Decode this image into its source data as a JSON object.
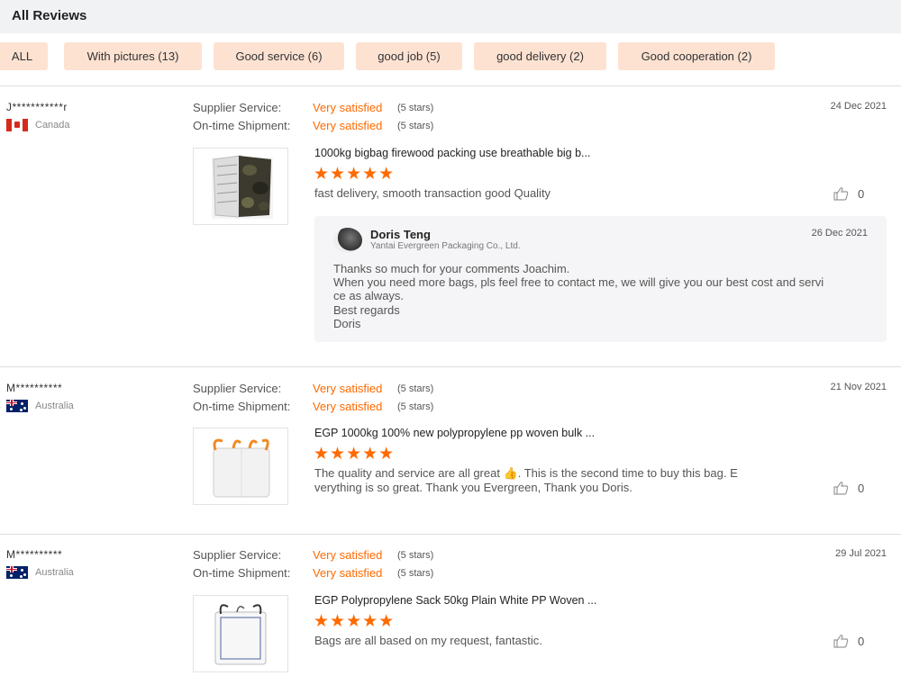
{
  "header": {
    "title": "All Reviews"
  },
  "filters": [
    "ALL",
    "With pictures (13)",
    "Good service (6)",
    "good job (5)",
    "good delivery (2)",
    "Good cooperation (2)"
  ],
  "labels": {
    "supplier_service": "Supplier Service:",
    "ontime_shipment": "On-time Shipment:"
  },
  "colors": {
    "accent": "#ff6a00",
    "chip_bg": "#fde2d2",
    "header_bg": "#f1f2f4"
  },
  "reviews": [
    {
      "user": "J***********r",
      "country": "Canada",
      "date": "24 Dec 2021",
      "supplier_rating": "Very satisfied",
      "supplier_stars": "(5 stars)",
      "shipment_rating": "Very satisfied",
      "shipment_stars": "(5 stars)",
      "product": "1000kg bigbag firewood packing use breathable big b...",
      "stars": "★★★★★",
      "comment_lines": [
        "fast delivery, smooth transaction good Quality"
      ],
      "likes": "0",
      "reply": {
        "name": "Doris Teng",
        "company": "Yantai Evergreen Packaging Co., Ltd.",
        "date": "26 Dec 2021",
        "lines": [
          "Thanks so much for your comments Joachim.",
          "When you need more bags, pls feel free to contact me, we will give you our best cost and servi",
          "ce as always.",
          "Best regards",
          "Doris"
        ]
      }
    },
    {
      "user": "M**********",
      "country": "Australia",
      "date": "21 Nov 2021",
      "supplier_rating": "Very satisfied",
      "supplier_stars": "(5 stars)",
      "shipment_rating": "Very satisfied",
      "shipment_stars": "(5 stars)",
      "product": "EGP 1000kg 100% new polypropylene pp woven bulk ...",
      "stars": "★★★★★",
      "comment_lines": [
        "The quality and service are all great 👍. This is the second time to buy this bag. E",
        "verything is so great.  Thank you Evergreen, Thank you Doris."
      ],
      "likes": "0"
    },
    {
      "user": "M**********",
      "country": "Australia",
      "date": "29 Jul 2021",
      "supplier_rating": "Very satisfied",
      "supplier_stars": "(5 stars)",
      "shipment_rating": "Very satisfied",
      "shipment_stars": "(5 stars)",
      "product": "EGP Polypropylene Sack 50kg Plain White PP Woven ...",
      "stars": "★★★★★",
      "comment_lines": [
        "Bags are all based on my request, fantastic."
      ],
      "likes": "0"
    }
  ]
}
